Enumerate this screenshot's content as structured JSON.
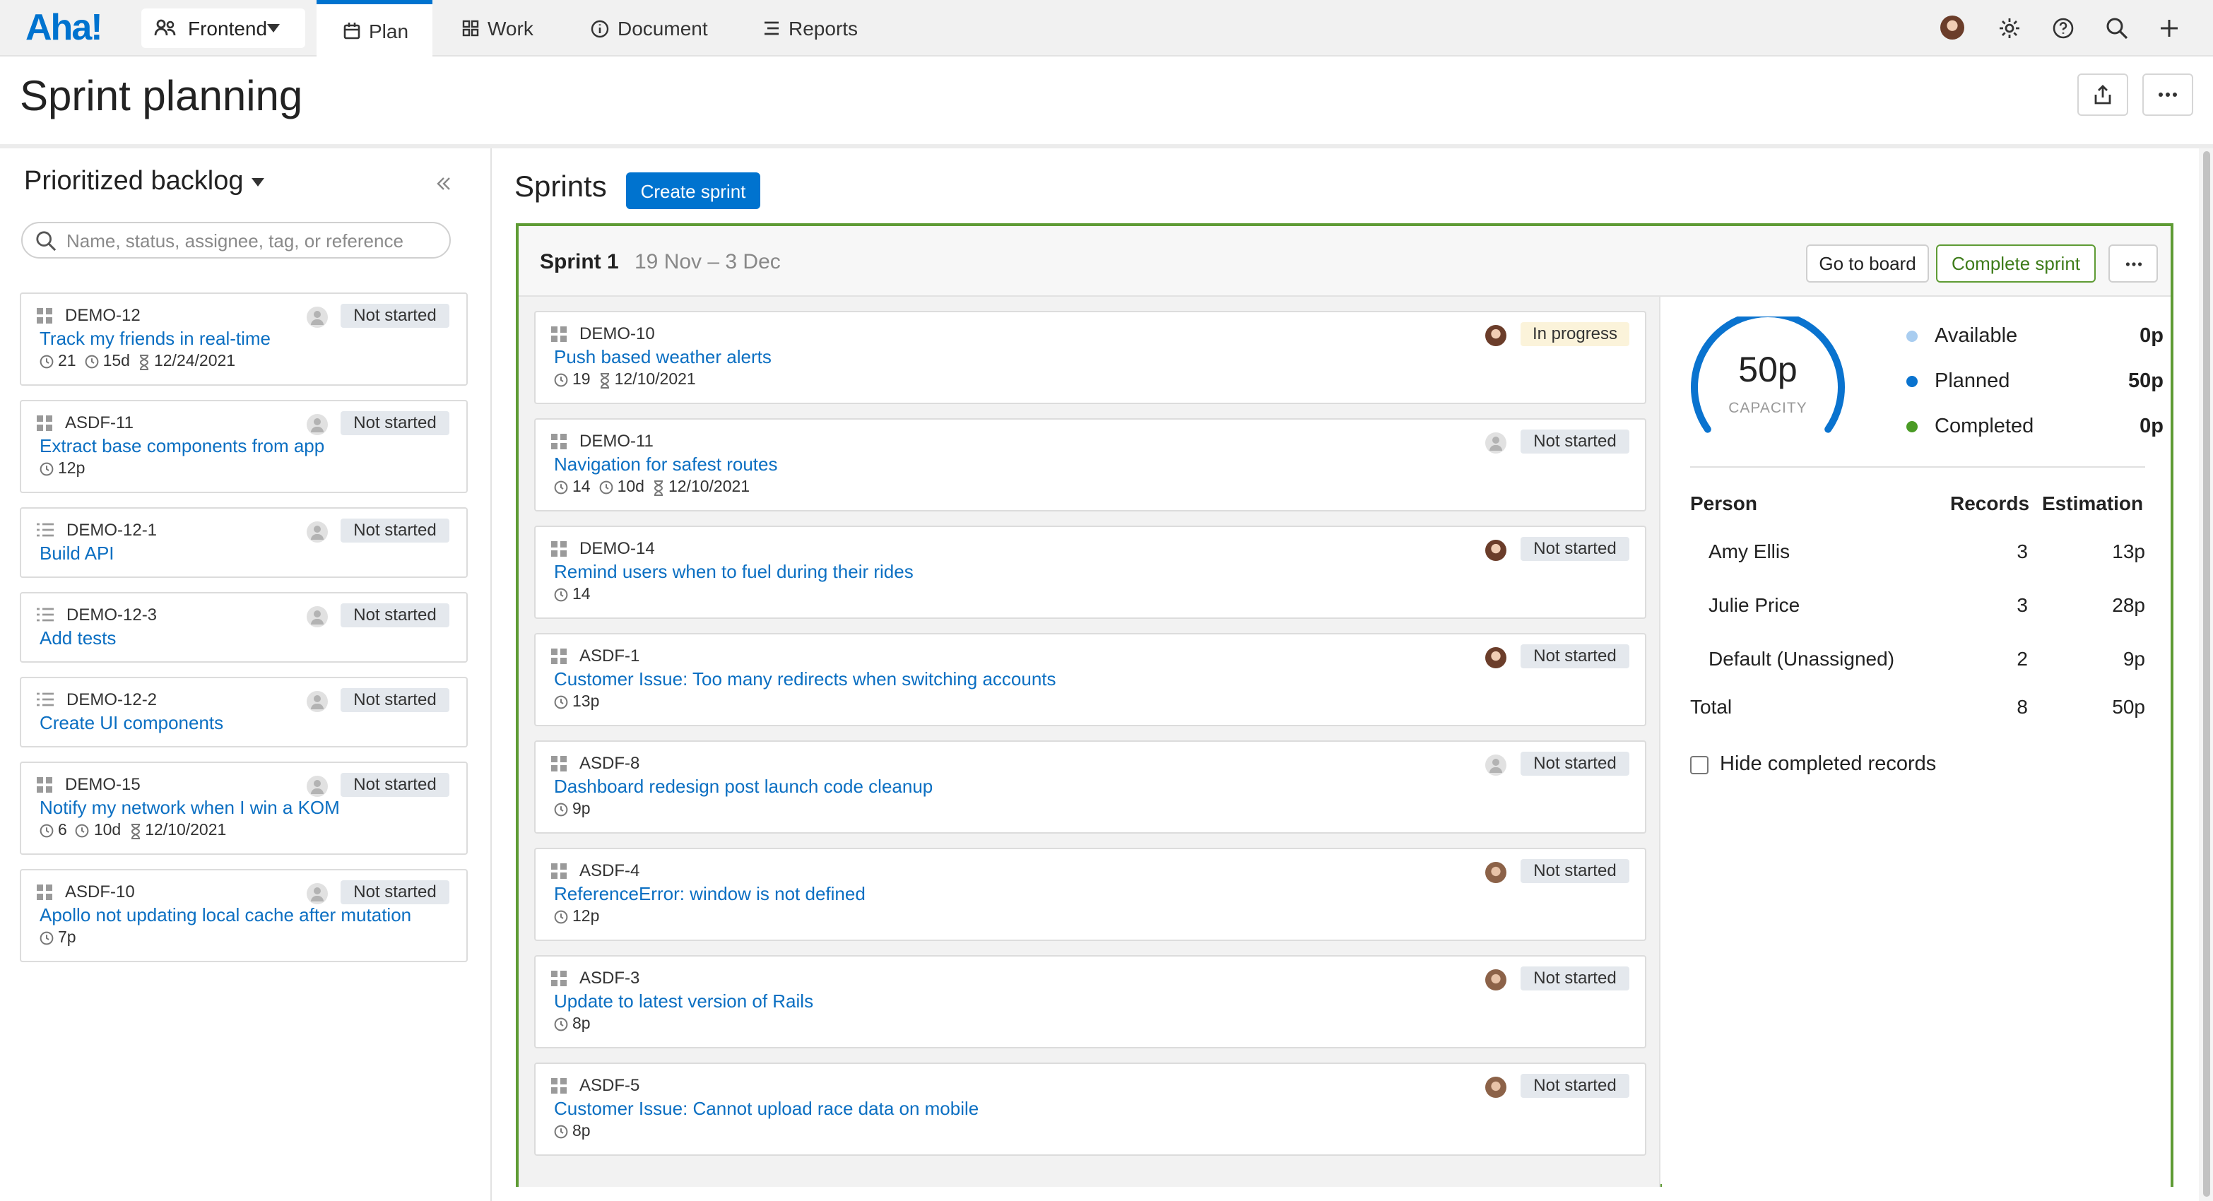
{
  "app": {
    "logo": "Aha!",
    "workspace": "Frontend",
    "nav": [
      "Plan",
      "Work",
      "Document",
      "Reports"
    ]
  },
  "page": {
    "title": "Sprint planning"
  },
  "backlog": {
    "title": "Prioritized backlog",
    "search_placeholder": "Name, status, assignee, tag, or reference",
    "items": [
      {
        "ref": "DEMO-12",
        "name": "Track my friends in real-time",
        "status": "Not started",
        "icon": "feature-icon",
        "meta": [
          "21",
          "15d",
          "12/24/2021"
        ]
      },
      {
        "ref": "ASDF-11",
        "name": "Extract base components from app",
        "status": "Not started",
        "icon": "feature-icon",
        "meta": [
          "12p"
        ]
      },
      {
        "ref": "DEMO-12-1",
        "name": "Build API",
        "status": "Not started",
        "icon": "requirement-icon",
        "meta": []
      },
      {
        "ref": "DEMO-12-3",
        "name": "Add tests",
        "status": "Not started",
        "icon": "requirement-icon",
        "meta": []
      },
      {
        "ref": "DEMO-12-2",
        "name": "Create UI components",
        "status": "Not started",
        "icon": "requirement-icon",
        "meta": []
      },
      {
        "ref": "DEMO-15",
        "name": "Notify my network when I win a KOM",
        "status": "Not started",
        "icon": "feature-icon",
        "meta": [
          "6",
          "10d",
          "12/10/2021"
        ]
      },
      {
        "ref": "ASDF-10",
        "name": "Apollo not updating local cache after mutation",
        "status": "Not started",
        "icon": "feature-icon",
        "meta": [
          "7p"
        ]
      }
    ]
  },
  "sprints": {
    "title": "Sprints",
    "create_label": "Create sprint",
    "sprint": {
      "name": "Sprint 1",
      "dates": "19 Nov – 3 Dec",
      "go_to_board": "Go to board",
      "complete": "Complete sprint",
      "records": [
        {
          "ref": "DEMO-10",
          "name": "Push based weather alerts",
          "status": "In progress",
          "avatar": "photo",
          "meta": [
            "19",
            "12/10/2021"
          ]
        },
        {
          "ref": "DEMO-11",
          "name": "Navigation for safest routes",
          "status": "Not started",
          "avatar": "empty",
          "meta": [
            "14",
            "10d",
            "12/10/2021"
          ]
        },
        {
          "ref": "DEMO-14",
          "name": "Remind users when to fuel during their rides",
          "status": "Not started",
          "avatar": "photo",
          "meta": [
            "14"
          ]
        },
        {
          "ref": "ASDF-1",
          "name": "Customer Issue: Too many redirects when switching accounts",
          "status": "Not started",
          "avatar": "photo",
          "meta": [
            "13p"
          ]
        },
        {
          "ref": "ASDF-8",
          "name": "Dashboard redesign post launch code cleanup",
          "status": "Not started",
          "avatar": "empty",
          "meta": [
            "9p"
          ]
        },
        {
          "ref": "ASDF-4",
          "name": "ReferenceError: window is not defined",
          "status": "Not started",
          "avatar": "photo2",
          "meta": [
            "12p"
          ]
        },
        {
          "ref": "ASDF-3",
          "name": "Update to latest version of Rails",
          "status": "Not started",
          "avatar": "photo2",
          "meta": [
            "8p"
          ]
        },
        {
          "ref": "ASDF-5",
          "name": "Customer Issue: Cannot upload race data on mobile",
          "status": "Not started",
          "avatar": "photo2",
          "meta": [
            "8p"
          ]
        }
      ],
      "capacity": {
        "value": "50p",
        "label": "CAPACITY",
        "planned_fraction": 1.0,
        "legend": [
          {
            "label": "Available",
            "value": "0p",
            "color": "#a9cdf0"
          },
          {
            "label": "Planned",
            "value": "50p",
            "color": "#0a73cf"
          },
          {
            "label": "Completed",
            "value": "0p",
            "color": "#4a9b25"
          }
        ],
        "table": {
          "headers": [
            "Person",
            "Records",
            "Estimation"
          ],
          "rows": [
            [
              "Amy Ellis",
              "3",
              "13p"
            ],
            [
              "Julie Price",
              "3",
              "28p"
            ],
            [
              "Default (Unassigned)",
              "2",
              "9p"
            ]
          ],
          "total": [
            "Total",
            "8",
            "50p"
          ]
        },
        "hide_completed": "Hide completed records"
      }
    }
  }
}
